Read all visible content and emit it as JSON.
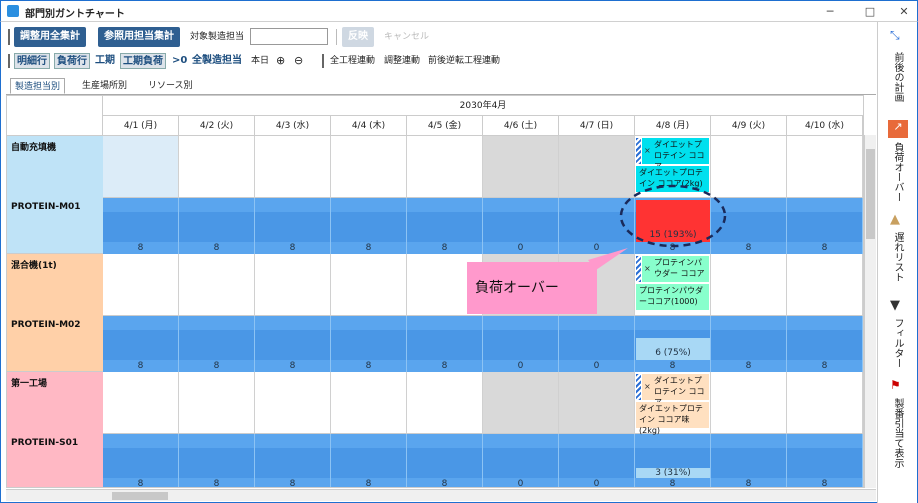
{
  "window": {
    "title": "部門別ガントチャート",
    "min": "─",
    "max": "□",
    "close": "✕"
  },
  "toolbar1": {
    "btn_adjust": "調整用全集計",
    "btn_ref": "参照用担当集計",
    "target_label": "対象製造担当",
    "target_value": "",
    "btn_apply": "反映",
    "btn_cancel": "キャンセル"
  },
  "toolbar2": {
    "detail_row": "明細行",
    "load_row": "負荷行",
    "period": "工期",
    "period_load": "工期負荷",
    "gt0": ">0",
    "all_mfg": "全製造担当",
    "today": "本日",
    "all_link": "全工程連動",
    "adjust_link": "調整連動",
    "fwd_back_link": "前後逆転工程連動"
  },
  "tabs": [
    "製造担当別",
    "生産場所別",
    "リソース別"
  ],
  "grid": {
    "month": "2030年4月",
    "days": [
      "4/1 (月)",
      "4/2 (火)",
      "4/3 (水)",
      "4/4 (木)",
      "4/5 (金)",
      "4/6 (土)",
      "4/7 (日)",
      "4/8 (月)",
      "4/9 (火)",
      "4/10 (水)"
    ],
    "groups": [
      {
        "name": "自動充填機",
        "resource": "PROTEIN-M01",
        "color": "#bfe3f7",
        "capacity": [
          "8",
          "8",
          "8",
          "8",
          "8",
          "0",
          "0",
          "8",
          "8",
          "8"
        ],
        "card_title": "ダイエットプロテイン ココア",
        "card_detail": "ダイエットプロテイン ココア(2kg)",
        "card_color": "#00e0ee",
        "load": "15 (193%)",
        "load_color": "#ff3333"
      },
      {
        "name": "混合機(1t)",
        "resource": "PROTEIN-M02",
        "color": "#ffd0a8",
        "capacity": [
          "8",
          "8",
          "8",
          "8",
          "8",
          "0",
          "0",
          "8",
          "8",
          "8"
        ],
        "card_title": "プロテインパウダー ココア",
        "card_detail": "プロテインパウダーココア(1000)",
        "card_color": "#88ffcc",
        "load": "6 (75%)",
        "load_color": "#a8d8f5"
      },
      {
        "name": "第一工場",
        "resource": "PROTEIN-S01",
        "color": "#ffb8c4",
        "capacity": [
          "8",
          "8",
          "8",
          "8",
          "8",
          "0",
          "0",
          "8",
          "8",
          "8"
        ],
        "card_title": "ダイエットプロテイン ココア",
        "card_detail": "ダイエットプロテイン ココア味(2kg)",
        "card_color": "#ffe0c0",
        "load": "3 (31%)",
        "load_color": "#a8d8f5"
      }
    ]
  },
  "callout": {
    "text": "負荷オーバー"
  },
  "side": {
    "plan": "前後の計画",
    "overload": "負荷オーバー",
    "delay": "遅れリスト",
    "filter": "フィルター",
    "assign": "製番引当て表示"
  }
}
